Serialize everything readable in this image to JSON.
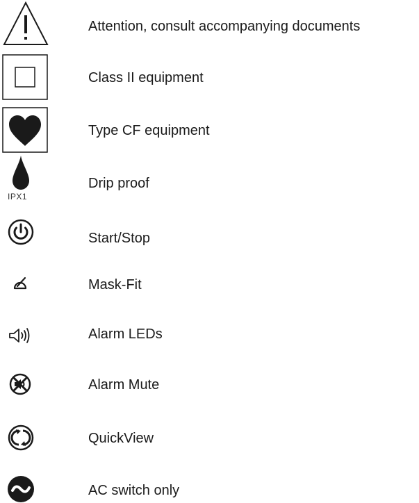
{
  "symbols": [
    {
      "icon": "warning-triangle-icon",
      "label": "Attention, consult accompanying documents"
    },
    {
      "icon": "class-ii-square-icon",
      "label": "Class II equipment"
    },
    {
      "icon": "heart-icon",
      "label": "Type CF equipment"
    },
    {
      "icon": "drop-icon",
      "label": "Drip proof",
      "code": "IPX1"
    },
    {
      "icon": "power-icon",
      "label": "Start/Stop"
    },
    {
      "icon": "mask-fit-icon",
      "label": "Mask-Fit"
    },
    {
      "icon": "speaker-icon",
      "label": "Alarm LEDs"
    },
    {
      "icon": "alarm-mute-icon",
      "label": "Alarm Mute"
    },
    {
      "icon": "quickview-icon",
      "label": "QuickView"
    },
    {
      "icon": "ac-switch-icon",
      "label": "AC switch only"
    }
  ]
}
